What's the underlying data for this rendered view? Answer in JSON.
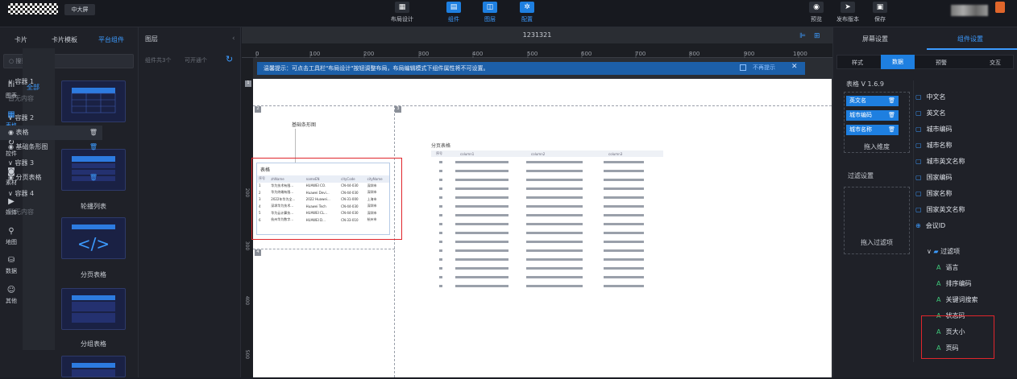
{
  "topbar": {
    "screen_btn": "中大屏",
    "layout_design": "布局设计",
    "components": "组件",
    "layers": "图层",
    "config": "配置",
    "preview": "预览",
    "publish": "发布版本",
    "save": "保存"
  },
  "left_panel": {
    "tabs": [
      "卡片",
      "卡片模板",
      "平台组件"
    ],
    "search_placeholder": "搜索",
    "categories": [
      {
        "icon": "chart-icon",
        "label": "图表"
      },
      {
        "icon": "table-icon",
        "label": "表格"
      },
      {
        "icon": "control-icon",
        "label": "控件"
      },
      {
        "icon": "material-icon",
        "label": "素材"
      },
      {
        "icon": "media-icon",
        "label": "媒体"
      },
      {
        "icon": "map-icon",
        "label": "地图"
      },
      {
        "icon": "data-icon",
        "label": "数据"
      },
      {
        "icon": "other-icon",
        "label": "其他"
      }
    ],
    "all_label": "全部",
    "components": [
      "表格",
      "轮播列表",
      "分页表格",
      "分组表格"
    ]
  },
  "layers": {
    "title": "图层",
    "summary_a": "组件共3个",
    "summary_b": "可开通个",
    "containers": [
      {
        "label": "容器 1",
        "empty": "暂无内容"
      },
      {
        "label": "容器 2",
        "items": [
          "表格",
          "基础条形图"
        ]
      },
      {
        "label": "容器 3",
        "items": [
          "分页表格"
        ]
      },
      {
        "label": "容器 4",
        "empty": "暂无内容"
      }
    ]
  },
  "canvas": {
    "title": "1231321",
    "ruler_ticks": [
      "0",
      "100",
      "200",
      "300",
      "400",
      "500",
      "600",
      "700",
      "800",
      "900",
      "1000"
    ],
    "v_ruler_ticks": [
      "100",
      "200",
      "300",
      "400",
      "500"
    ],
    "tip": "温馨提示：可点击工具栏\"布局设计\"按钮调整布局，布局编辑模式下组件属性将不可设置。",
    "no_more_tip": "不再提示",
    "bar_chart_title": "基础条形图",
    "table_title": "表格",
    "table_headers": [
      "序号",
      "zhName",
      "nameEN",
      "cityCode",
      "cityName"
    ],
    "table_rows": [
      [
        "1",
        "华为技术有限...",
        "HUAWEI CO.",
        "CN-44-030",
        "深圳市"
      ],
      [
        "2",
        "华为终端有限...",
        "Huawei Devi...",
        "CN-44-030",
        "深圳市"
      ],
      [
        "3",
        "2022年华为全...",
        "2022 Huawei...",
        "CN-31-000",
        "上海市"
      ],
      [
        "4",
        "深圳华为技术...",
        "Huawei Tech",
        "CN-44-030",
        "深圳市"
      ],
      [
        "5",
        "华为云计算技...",
        "HUAWEI CL...",
        "CN-44-030",
        "深圳市"
      ],
      [
        "6",
        "杭州华为数字...",
        "HUAWEI D...",
        "CN-33-010",
        "杭州市"
      ]
    ],
    "paged_title": "分页表格",
    "paged_headers": [
      "序号",
      "column1",
      "column2",
      "column3"
    ],
    "paged_rows": 15
  },
  "right_panel": {
    "tabs": [
      "屏幕设置",
      "组件设置"
    ],
    "subtabs": [
      "样式",
      "数据",
      "预警",
      "交互"
    ],
    "version": "表格  V 1.6.9",
    "chips": [
      "英文名",
      "城市编码",
      "城市名称"
    ],
    "drop_dim": "拖入维度",
    "filter_settings": "过滤设置",
    "drop_filter": "拖入过滤项",
    "fields": [
      "中文名",
      "英文名",
      "城市编码",
      "城市名称",
      "城市英文名称",
      "国家编码",
      "国家名称",
      "国家英文名称",
      "会议ID"
    ],
    "filter_group": "过滤项",
    "filter_items": [
      "语言",
      "排序编码",
      "关键词搜索",
      "状态码",
      "页大小",
      "页码"
    ]
  }
}
